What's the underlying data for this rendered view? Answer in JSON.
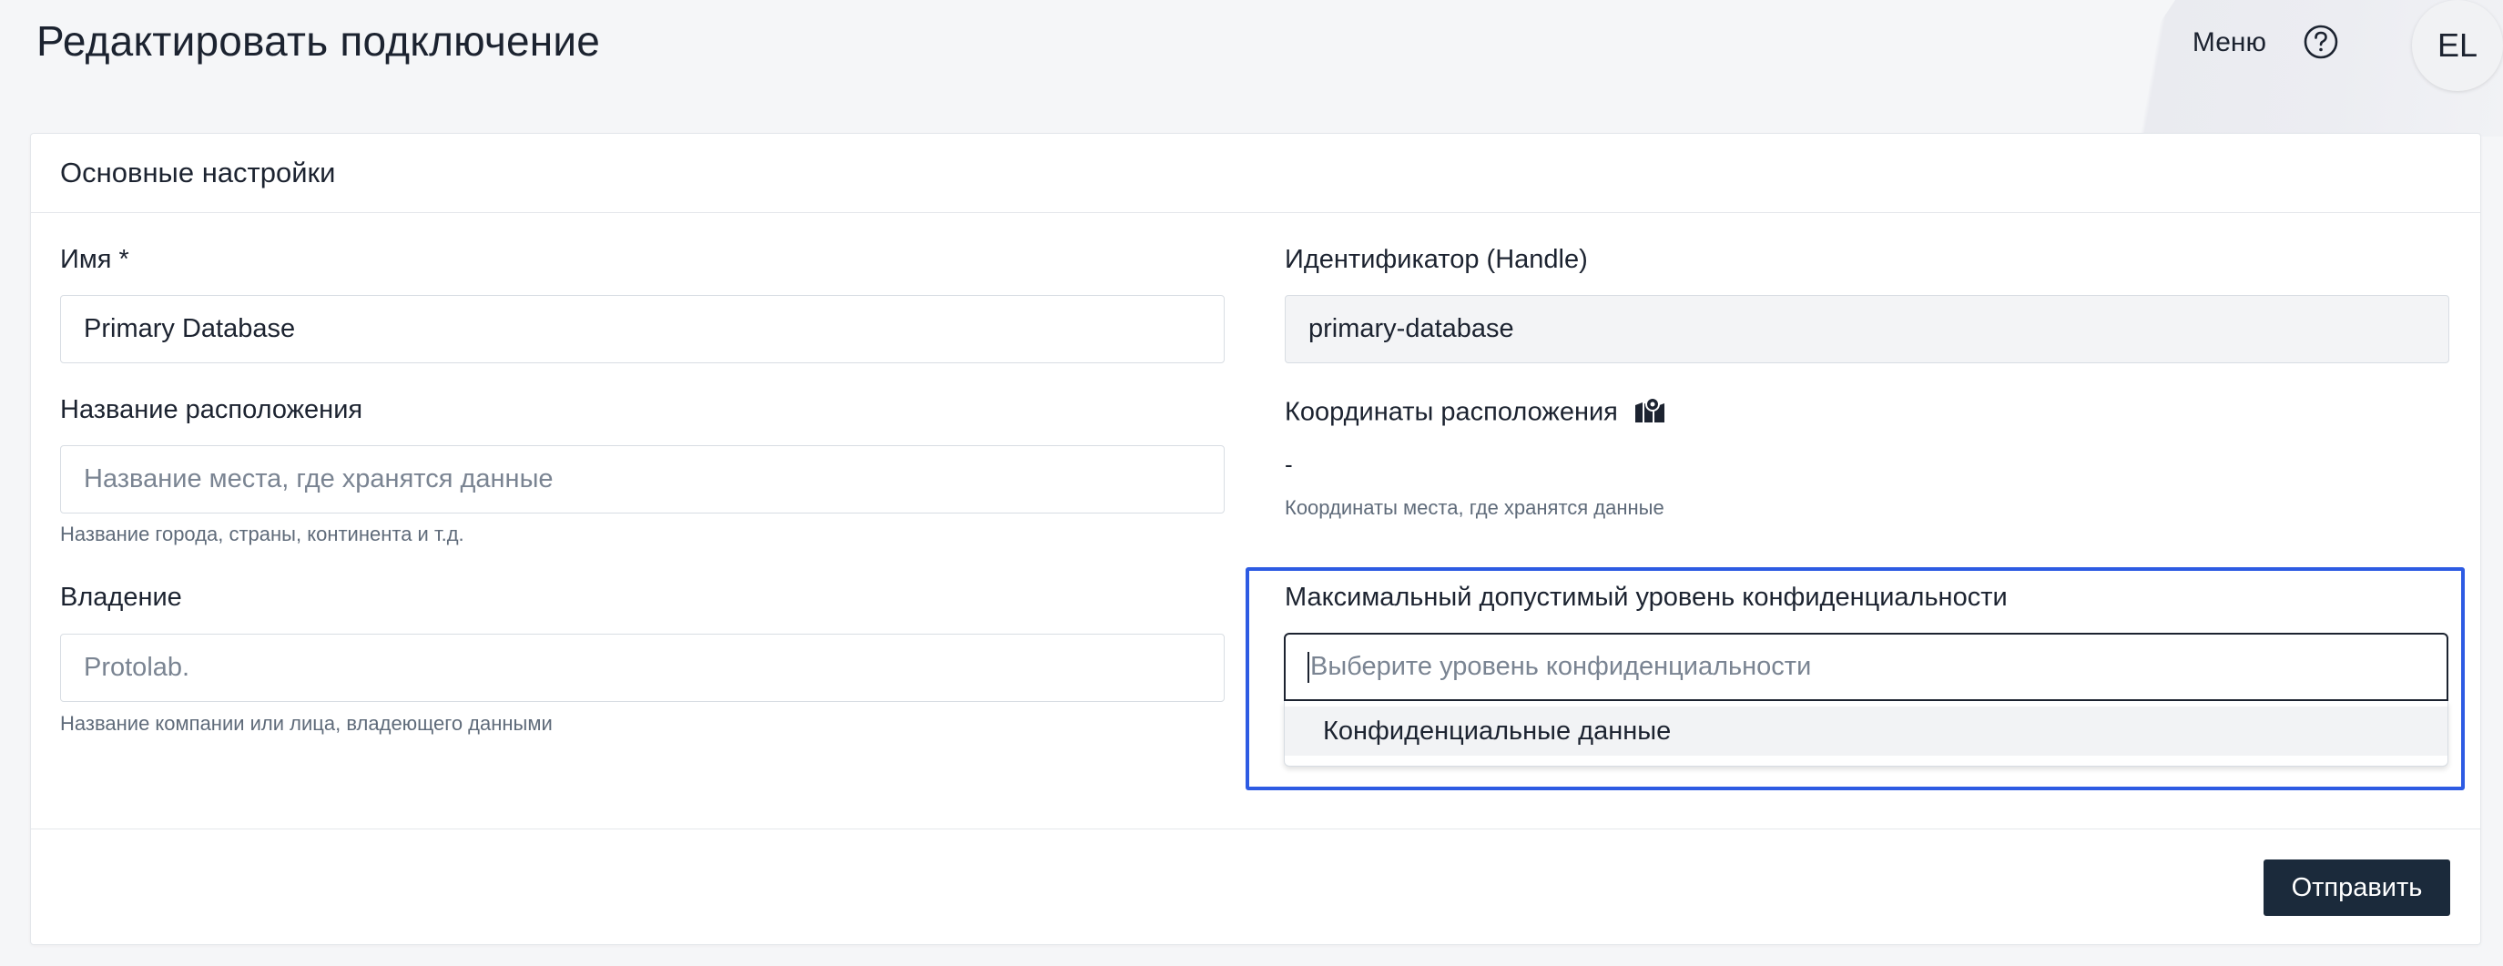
{
  "header": {
    "title": "Редактировать подключение",
    "menu_label": "Меню",
    "help_icon": "question-circle-icon",
    "avatar_initials": "EL"
  },
  "card": {
    "section_title": "Основные настройки",
    "name": {
      "label": "Имя *",
      "value": "Primary Database"
    },
    "handle": {
      "label": "Идентификатор (Handle)",
      "value": "primary-database"
    },
    "location_name": {
      "label": "Название расположения",
      "placeholder": "Название места, где хранятся данные",
      "help": "Название города, страны, континента и т.д."
    },
    "location_coords": {
      "label": "Координаты расположения",
      "icon": "map-marker-icon",
      "value": "-",
      "help": "Координаты места, где хранятся данные"
    },
    "ownership": {
      "label": "Владение",
      "placeholder": "Protolab.",
      "help": "Название компании или лица, владеющего данными"
    },
    "confidentiality": {
      "label": "Максимальный допустимый уровень конфиденциальности",
      "placeholder": "Выберите уровень конфиденциальности",
      "options": [
        "Конфиденциальные данные"
      ]
    },
    "submit_label": "Отправить"
  },
  "colors": {
    "primary_button": "#1b2a3b",
    "focus_highlight": "#2d5be3"
  }
}
